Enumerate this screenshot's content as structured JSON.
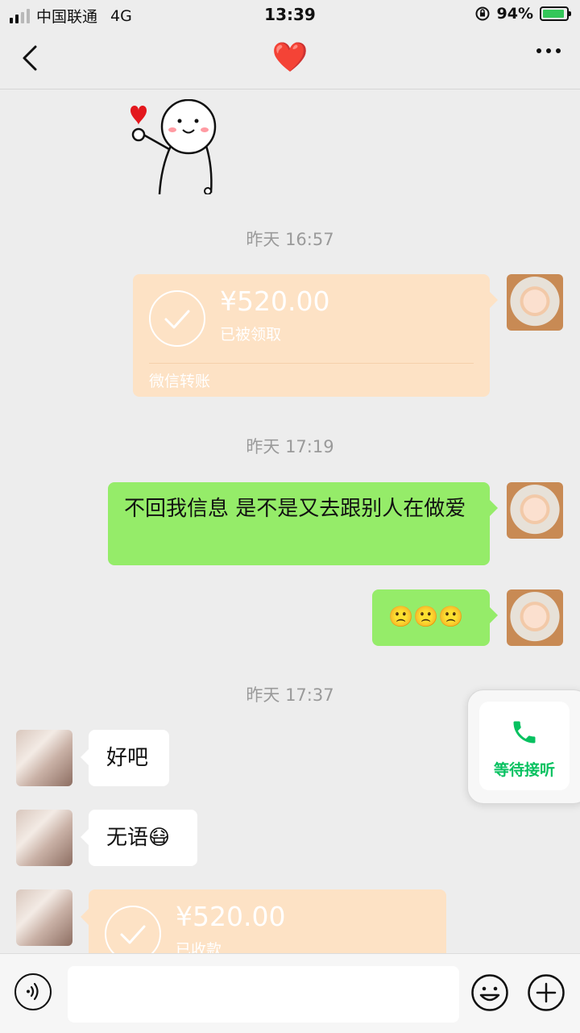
{
  "status_bar": {
    "carrier": "中国联通",
    "network": "4G",
    "time": "13:39",
    "battery_pct": "94%",
    "signal_bars_filled": 2,
    "signal_bars_total": 4,
    "battery_level": 0.94
  },
  "nav": {
    "title": "❤️",
    "back_icon": "chevron-left-icon",
    "more_icon": "ellipsis-icon"
  },
  "messages": {
    "ts1": "昨天 16:57",
    "ts2": "昨天 17:19",
    "ts3": "昨天 17:37",
    "transfer1": {
      "amount": "¥520.00",
      "status": "已被领取",
      "footer": "微信转账"
    },
    "text1": "不回我信息 是不是又去跟别人在做爱",
    "emoji1": "🙁🙁🙁",
    "text2": "好吧",
    "text3": "无语😷",
    "transfer2": {
      "amount": "¥520.00",
      "status": "已收款"
    }
  },
  "call_widget": {
    "label": "等待接听",
    "icon": "phone-icon"
  },
  "input_bar": {
    "voice_icon": "voice-icon",
    "emoji_icon": "emoji-icon",
    "plus_icon": "plus-icon"
  },
  "colors": {
    "background": "#ededed",
    "sent_bubble": "#95ec69",
    "received_bubble": "#ffffff",
    "transfer_bubble": "#fde2c5",
    "accent_green": "#07c160",
    "heart_red": "#e3171d"
  }
}
